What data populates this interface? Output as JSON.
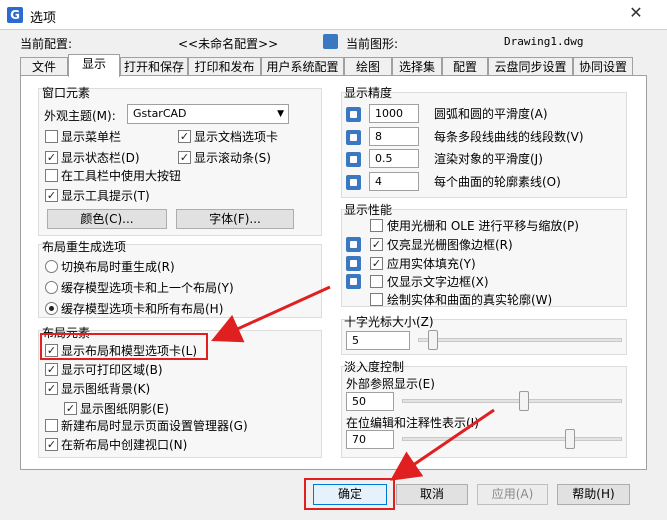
{
  "window": {
    "title": "选项",
    "close_glyph": "✕",
    "app_icon_letter": "G"
  },
  "config": {
    "current_config_label": "当前配置:",
    "current_config_value": "<<未命名配置>>",
    "current_drawing_label": "当前图形:",
    "current_drawing_value": "Drawing1.dwg"
  },
  "tabs": [
    {
      "label": "文件"
    },
    {
      "label": "显示"
    },
    {
      "label": "打开和保存"
    },
    {
      "label": "打印和发布"
    },
    {
      "label": "用户系统配置"
    },
    {
      "label": "绘图"
    },
    {
      "label": "选择集"
    },
    {
      "label": "配置"
    },
    {
      "label": "云盘同步设置"
    },
    {
      "label": "协同设置"
    }
  ],
  "active_tab": "显示",
  "window_elements": {
    "title": "窗口元素",
    "theme_label": "外观主题(M):",
    "theme_value": "GstarCAD",
    "checkboxes": [
      {
        "label": "显示菜单栏",
        "checked": false,
        "mark": ""
      },
      {
        "label": "显示文档选项卡",
        "checked": true,
        "mark": "✓"
      },
      {
        "label": "显示状态栏(D)",
        "checked": true,
        "mark": "✓"
      },
      {
        "label": "显示滚动条(S)",
        "checked": true,
        "mark": "✓"
      },
      {
        "label": "在工具栏中使用大按钮",
        "checked": false,
        "mark": ""
      },
      {
        "label": "显示工具提示(T)",
        "checked": true,
        "mark": "✓"
      }
    ],
    "colors_button": "颜色(C)...",
    "fonts_button": "字体(F)..."
  },
  "layout_regen": {
    "title": "布局重生成选项",
    "options": [
      {
        "label": "切换布局时重生成(R)",
        "selected": false
      },
      {
        "label": "缓存模型选项卡和上一个布局(Y)",
        "selected": false
      },
      {
        "label": "缓存模型选项卡和所有布局(H)",
        "selected": true
      }
    ]
  },
  "layout_elements": {
    "title": "布局元素",
    "checkboxes": [
      {
        "label": "显示布局和模型选项卡(L)",
        "checked": true,
        "mark": "✓"
      },
      {
        "label": "显示可打印区域(B)",
        "checked": true,
        "mark": "✓"
      },
      {
        "label": "显示图纸背景(K)",
        "checked": true,
        "mark": "✓"
      },
      {
        "label": "显示图纸阴影(E)",
        "checked": true,
        "mark": "✓"
      },
      {
        "label": "新建布局时显示页面设置管理器(G)",
        "checked": false,
        "mark": ""
      },
      {
        "label": "在新布局中创建视口(N)",
        "checked": true,
        "mark": "✓"
      }
    ]
  },
  "display_precision": {
    "title": "显示精度",
    "rows": [
      {
        "value": "1000",
        "label": "圆弧和圆的平滑度(A)"
      },
      {
        "value": "8",
        "label": "每条多段线曲线的线段数(V)"
      },
      {
        "value": "0.5",
        "label": "渲染对象的平滑度(J)"
      },
      {
        "value": "4",
        "label": "每个曲面的轮廓素线(O)"
      }
    ]
  },
  "display_performance": {
    "title": "显示性能",
    "checkboxes": [
      {
        "label": "使用光栅和 OLE 进行平移与缩放(P)",
        "checked": false,
        "mark": "",
        "icon": false
      },
      {
        "label": "仅亮显光栅图像边框(R)",
        "checked": true,
        "mark": "✓",
        "icon": true
      },
      {
        "label": "应用实体填充(Y)",
        "checked": true,
        "mark": "✓",
        "icon": true
      },
      {
        "label": "仅显示文字边框(X)",
        "checked": false,
        "mark": "",
        "icon": true
      },
      {
        "label": "绘制实体和曲面的真实轮廓(W)",
        "checked": false,
        "mark": "",
        "icon": false
      }
    ]
  },
  "crosshair": {
    "title": "十字光标大小(Z)",
    "value": "5",
    "level": 5
  },
  "fade": {
    "title": "淡入度控制",
    "xref_label": "外部参照显示(E)",
    "xref_value": "50",
    "xref_level": 50,
    "inplace_label": "在位编辑和注释性表示(I)",
    "inplace_value": "70",
    "inplace_level": 70
  },
  "buttons": {
    "ok": "确定",
    "cancel": "取消",
    "apply": "应用(A)",
    "help": "帮助(H)"
  },
  "colors": {
    "annotation_red": "#e02020",
    "accent_blue": "#3b78c2"
  },
  "icons": [
    "close-icon",
    "dropdown-arrow-icon",
    "drawing-icon",
    "precision-icon",
    "arrow-icon"
  ]
}
